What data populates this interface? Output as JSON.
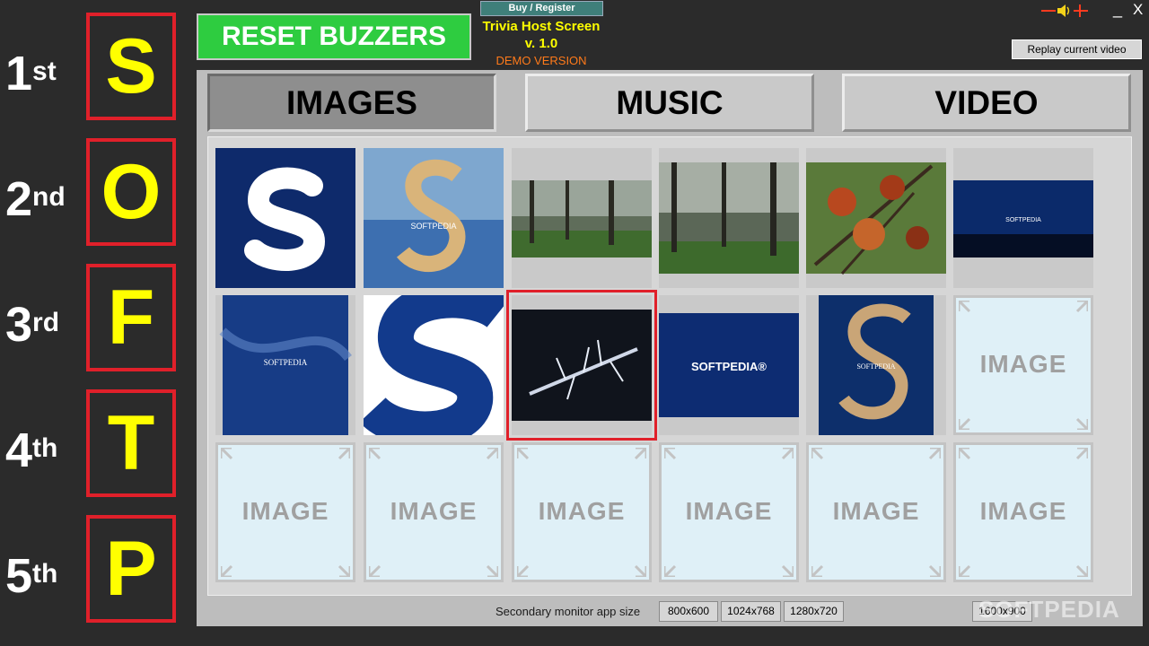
{
  "buttons": {
    "reset": "RESET BUZZERS",
    "buy_register": "Buy / Register",
    "replay": "Replay current video",
    "minimize": "_",
    "close": "X"
  },
  "app": {
    "name": "Trivia Host Screen",
    "version": "v. 1.0",
    "edition": "DEMO VERSION"
  },
  "rankings": [
    {
      "num": "1",
      "suffix": "st",
      "letter": "S"
    },
    {
      "num": "2",
      "suffix": "nd",
      "letter": "O"
    },
    {
      "num": "3",
      "suffix": "rd",
      "letter": "F"
    },
    {
      "num": "4",
      "suffix": "th",
      "letter": "T"
    },
    {
      "num": "5",
      "suffix": "th",
      "letter": "P"
    }
  ],
  "tabs": [
    {
      "label": "IMAGES",
      "active": true
    },
    {
      "label": "MUSIC",
      "active": false
    },
    {
      "label": "VIDEO",
      "active": false
    }
  ],
  "thumbnails": {
    "softpedia_text": "SOFTPEDIA",
    "softpedia_logo_text": "SOFTPEDIA®",
    "placeholder_label": "IMAGE"
  },
  "bottom": {
    "size_label": "Secondary monitor app size",
    "sizes": [
      "800x600",
      "1024x768",
      "1280x720",
      "1600x900"
    ],
    "watermark": "SOFTPEDIA"
  },
  "colors": {
    "accent_red": "#e0202a",
    "letter_yellow": "#ffff00",
    "reset_green": "#2ecc40",
    "demo_orange": "#ff7a1a",
    "placeholder_bg": "#dff0f7"
  }
}
